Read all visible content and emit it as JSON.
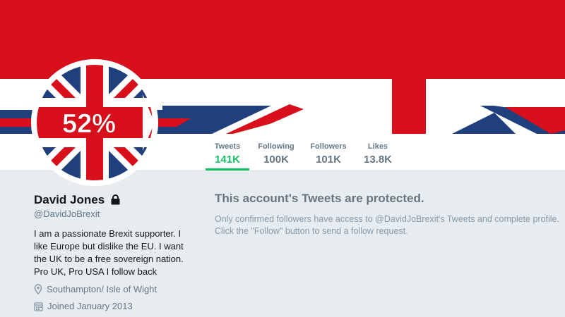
{
  "banner": {
    "description": "union-flag",
    "colors": {
      "red": "#d7101c",
      "white": "#ffffff",
      "blue": "#1f3f7d"
    }
  },
  "avatar": {
    "badge_text": "52%"
  },
  "stats": [
    {
      "label": "Tweets",
      "value": "141K",
      "active": true
    },
    {
      "label": "Following",
      "value": "100K",
      "active": false
    },
    {
      "label": "Followers",
      "value": "101K",
      "active": false
    },
    {
      "label": "Likes",
      "value": "13.8K",
      "active": false
    }
  ],
  "profile": {
    "name": "David Jones",
    "protected_icon": "lock-icon",
    "handle": "@DavidJoBrexit",
    "bio": "I am a passionate Brexit supporter. I like Europe but dislike the EU. I want the UK to be a free sovereign nation. Pro UK, Pro USA I follow back",
    "location": "Southampton/ Isle of Wight",
    "location_icon": "location-pin-icon",
    "joined": "Joined January 2013",
    "joined_icon": "calendar-icon"
  },
  "protected": {
    "title": "This account's Tweets are protected.",
    "message": "Only confirmed followers have access to @DavidJoBrexit's Tweets and complete profile. Click the \"Follow\" button to send a follow request."
  },
  "colors": {
    "accent": "#17bf63",
    "background": "#e6ecf0"
  }
}
